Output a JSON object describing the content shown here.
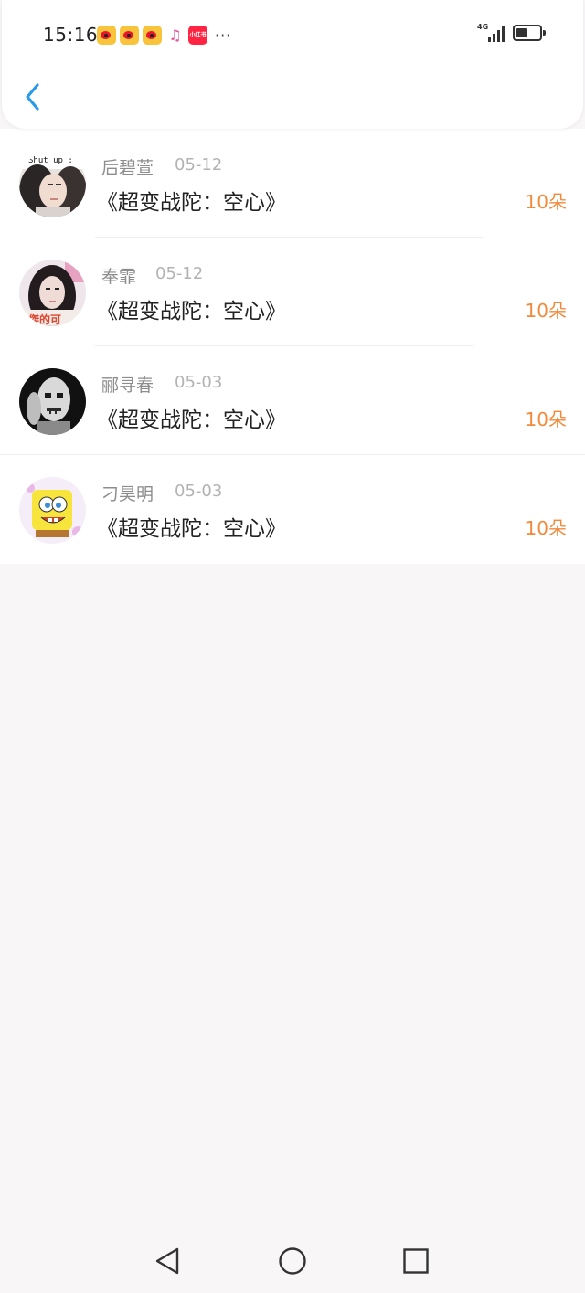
{
  "status_bar": {
    "time": "15:16",
    "notification_icons": [
      "weibo-icon",
      "weibo-icon",
      "weibo-icon",
      "music-note-icon",
      "xiaohongshu-icon"
    ],
    "xhs_label": "小红书",
    "more": "···",
    "network": "4G"
  },
  "header": {
    "back_icon": "chevron-left-icon"
  },
  "list": {
    "items": [
      {
        "name": "后碧萱",
        "date": "05-12",
        "title": "《超变战陀：空心》",
        "count": "10朵",
        "avatar_text": "Shut up :"
      },
      {
        "name": "奉霏",
        "date": "05-12",
        "title": "《超变战陀：空心》",
        "count": "10朵",
        "avatar_text": "傑的可"
      },
      {
        "name": "郦寻春",
        "date": "05-03",
        "title": "《超变战陀：空心》",
        "count": "10朵",
        "avatar_text": ""
      },
      {
        "name": "刁昊明",
        "date": "05-03",
        "title": "《超变战陀：空心》",
        "count": "10朵",
        "avatar_text": ""
      }
    ]
  },
  "colors": {
    "accent_back": "#2a9ae6",
    "count_orange": "#f28a3c",
    "background": "#f8f6f7"
  }
}
